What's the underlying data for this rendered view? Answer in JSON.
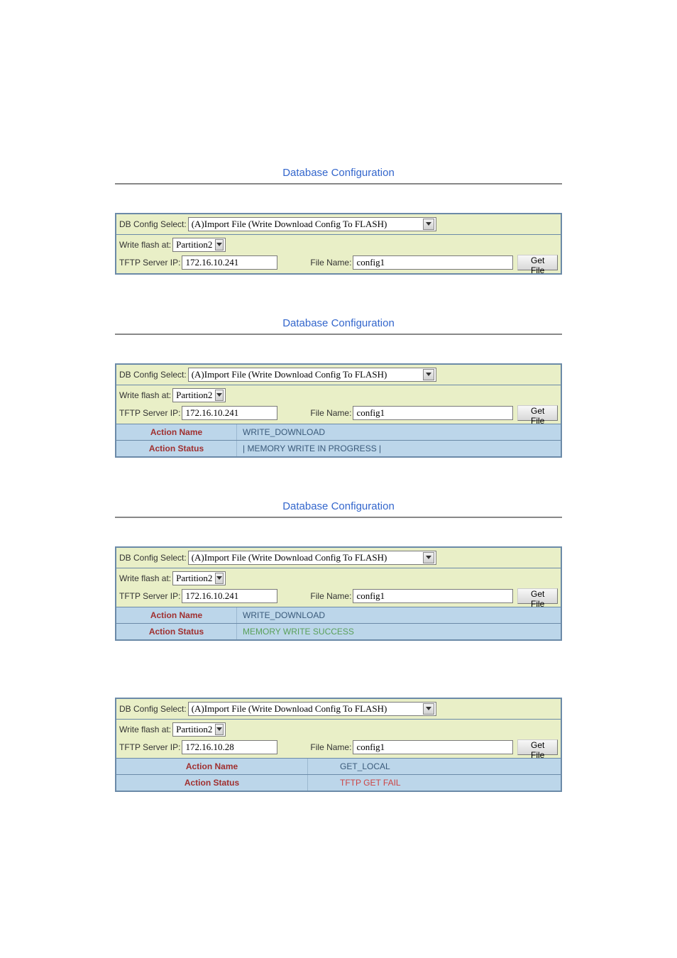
{
  "title": "Database Configuration",
  "labels": {
    "db_config_select": "DB Config Select:",
    "write_flash_at": "Write flash at:",
    "tftp_server_ip": "TFTP Server IP:",
    "file_name": "File Name:",
    "get_file": "Get File",
    "action_name": "Action Name",
    "action_status": "Action Status"
  },
  "db_config_option": "(A)Import File (Write Download Config To FLASH)",
  "partition_option": "Partition2",
  "blocks": [
    {
      "tftp_ip": "172.16.10.241",
      "file_name": "config1",
      "show_title": true,
      "status": null
    },
    {
      "tftp_ip": "172.16.10.241",
      "file_name": "config1",
      "show_title": true,
      "status": {
        "action_name": "WRITE_DOWNLOAD",
        "action_status": "| MEMORY WRITE IN PROGRESS |",
        "style": "normal"
      }
    },
    {
      "tftp_ip": "172.16.10.241",
      "file_name": "config1",
      "show_title": true,
      "status": {
        "action_name": "WRITE_DOWNLOAD",
        "action_status": "MEMORY WRITE SUCCESS",
        "style": "success"
      }
    },
    {
      "tftp_ip": "172.16.10.28",
      "file_name": "config1",
      "show_title": false,
      "status": {
        "action_name": "GET_LOCAL",
        "action_status": "TFTP GET FAIL",
        "style": "fail"
      }
    }
  ]
}
